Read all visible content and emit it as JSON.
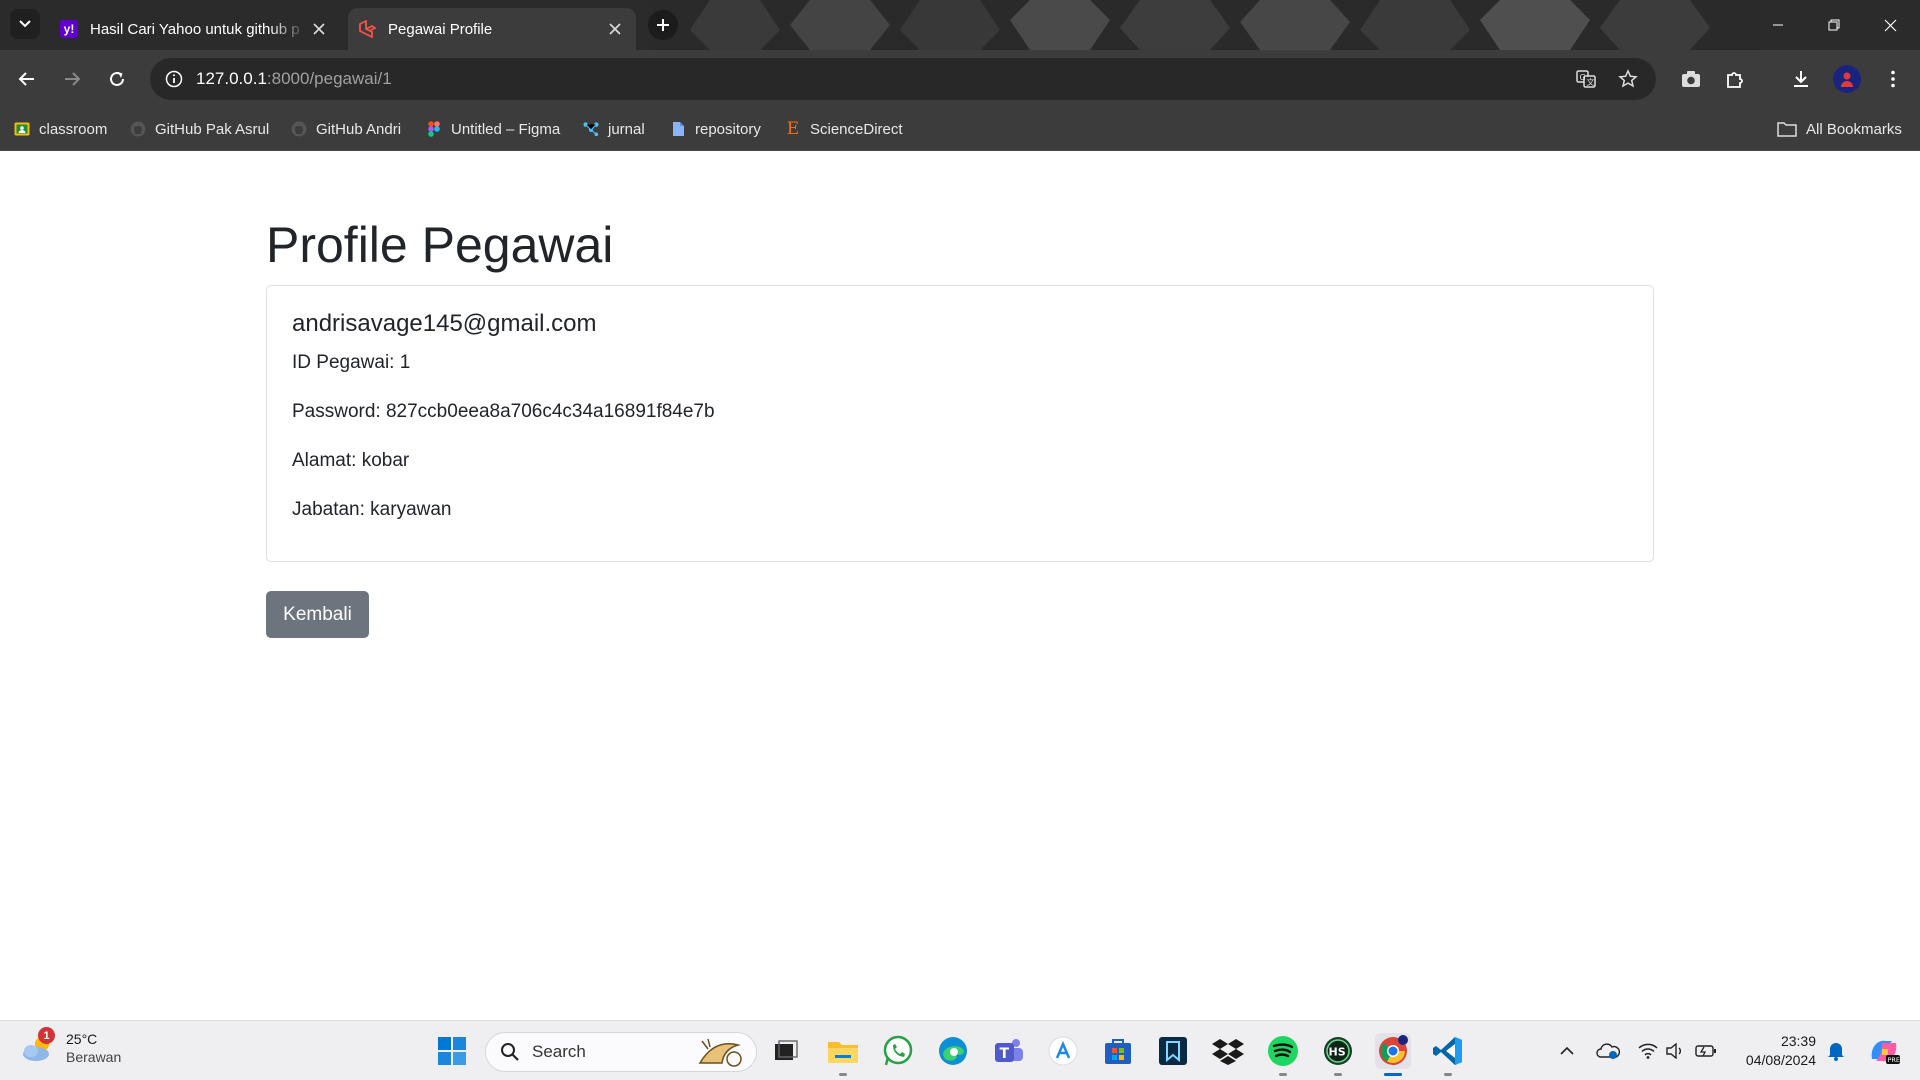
{
  "browser": {
    "tabs": [
      {
        "title": "Hasil Cari Yahoo untuk github p",
        "favicon": "yahoo-icon",
        "active": false
      },
      {
        "title": "Pegawai Profile",
        "favicon": "laravel-icon",
        "active": true
      }
    ],
    "url": {
      "host": "127.0.0.1",
      "path": ":8000/pegawai/1"
    },
    "bookmarks": [
      {
        "label": "classroom",
        "icon": "classroom-icon"
      },
      {
        "label": "GitHub Pak Asrul",
        "icon": "github-icon"
      },
      {
        "label": "GitHub Andri",
        "icon": "github-icon"
      },
      {
        "label": "Untitled – Figma",
        "icon": "figma-icon"
      },
      {
        "label": "jurnal",
        "icon": "jurnal-icon"
      },
      {
        "label": "repository",
        "icon": "file-icon"
      },
      {
        "label": "ScienceDirect",
        "icon": "elsevier-icon"
      }
    ],
    "all_bookmarks_label": "All Bookmarks"
  },
  "page": {
    "title": "Profile Pegawai",
    "card": {
      "email": "andrisavage145@gmail.com",
      "id_line": "ID Pegawai: 1",
      "password_line": "Password: 827ccb0eea8a706c4c34a16891f84e7b",
      "alamat_line": "Alamat: kobar",
      "jabatan_line": "Jabatan: karyawan"
    },
    "back_button": "Kembali"
  },
  "taskbar": {
    "weather": {
      "temp": "25°C",
      "condition": "Berawan",
      "badge": "1"
    },
    "search_placeholder": "Search",
    "clock": {
      "time": "23:39",
      "date": "04/08/2024"
    }
  },
  "colors": {
    "chrome_dark": "#3c3c3c",
    "button_secondary": "#6c757d",
    "text": "#212529"
  }
}
